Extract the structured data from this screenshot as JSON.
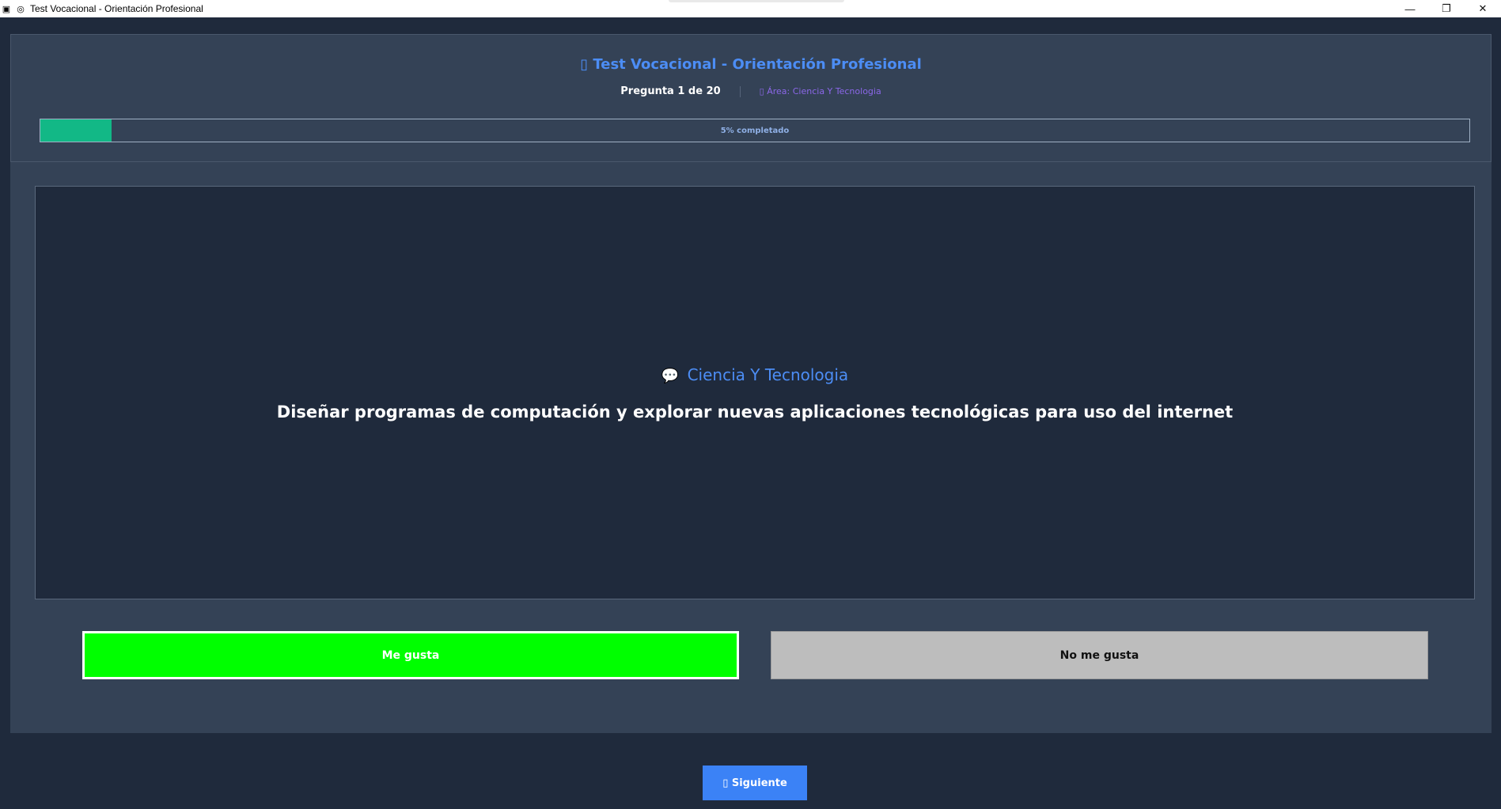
{
  "window": {
    "title": "Test Vocacional - Orientación Profesional",
    "controls": {
      "minimize": "—",
      "restore": "❐",
      "close": "✕"
    }
  },
  "header": {
    "app_title": "▯ Test Vocacional - Orientación Profesional",
    "question_counter": "Pregunta 1 de 20",
    "area_label": "▯ Área: Ciencia Y Tecnologia",
    "progress": {
      "fraction": 0.05,
      "label": "5% completado"
    }
  },
  "question": {
    "category_icon": "💬",
    "category": "Ciencia Y Tecnologia",
    "text": "Diseñar programas de computación y explorar nuevas aplicaciones tecnológicas para uso del internet"
  },
  "answers": {
    "like_label": "Me gusta",
    "dislike_label": "No me gusta"
  },
  "footer": {
    "next_label": "▯ Siguiente"
  },
  "colors": {
    "background": "#1f2a3c",
    "panel": "#344256",
    "accent": "#4c8df5",
    "progress": "#12b886",
    "like": "#00ff00",
    "dislike": "#bdbdbd",
    "next": "#3b82f6"
  }
}
